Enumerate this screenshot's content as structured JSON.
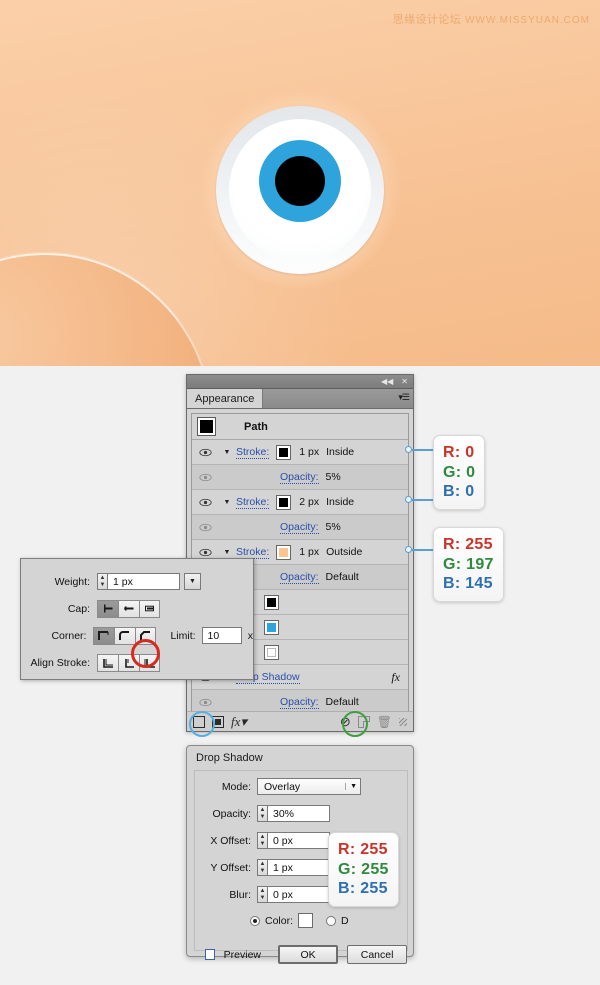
{
  "watermark": {
    "cn": "思缘设计论坛",
    "url": "WWW.MISSYUAN.COM"
  },
  "illustration": {
    "name": "eye-illustration",
    "background_color": "#f7c496",
    "iris_color": "#2fa3dc",
    "pupil_color": "#000000",
    "sclera_color": "#ffffff"
  },
  "appearance_panel": {
    "tab_label": "Appearance",
    "collapse_icon": "◀◀",
    "close_icon": "✕",
    "menu_icon": "▾☰",
    "header_row": {
      "label": "Path"
    },
    "rows": [
      {
        "label": "Stroke:",
        "value": "1 px",
        "align": "Inside",
        "swatch": "black"
      },
      {
        "label": "Opacity:",
        "value": "5%"
      },
      {
        "label": "Stroke:",
        "value": "2 px",
        "align": "Inside",
        "swatch": "black"
      },
      {
        "label": "Opacity:",
        "value": "5%"
      },
      {
        "label": "Stroke:",
        "value": "1 px",
        "align": "Outside",
        "swatch": "orange"
      },
      {
        "label": "Opacity:",
        "value": "Default"
      },
      {
        "label": "",
        "value": "",
        "swatch": "black"
      },
      {
        "label": "",
        "value": "",
        "swatch": "blue"
      },
      {
        "label": "",
        "value": "",
        "swatch": "white"
      },
      {
        "label": "Drop Shadow",
        "value": "",
        "fx": "fx"
      },
      {
        "label": "Opacity:",
        "value": "Default"
      }
    ],
    "footer": {
      "add_new_stroke_icon": "stroke-square",
      "add_new_fill_icon": "fill-square",
      "fx_icon": "fx",
      "clear_icon": "⃠",
      "duplicate_icon": "duplicate",
      "delete_icon": "🗑",
      "grip_icon": "grip"
    }
  },
  "stroke_popup": {
    "weight": {
      "label": "Weight:",
      "value": "1 px"
    },
    "cap": {
      "label": "Cap:"
    },
    "corner": {
      "label": "Corner:"
    },
    "limit": {
      "label": "Limit:",
      "value": "10",
      "unit": "x"
    },
    "align_stroke": {
      "label": "Align Stroke:"
    }
  },
  "callouts": [
    {
      "r": "R: 0",
      "g": "G: 0",
      "b": "B: 0"
    },
    {
      "r": "R: 255",
      "g": "G: 197",
      "b": "B: 145"
    },
    {
      "r": "R: 255",
      "g": "G: 255",
      "b": "B: 255"
    }
  ],
  "drop_shadow_dialog": {
    "title": "Drop Shadow",
    "mode": {
      "label": "Mode:",
      "value": "Overlay"
    },
    "opacity": {
      "label": "Opacity:",
      "value": "30%"
    },
    "x_offset": {
      "label": "X Offset:",
      "value": "0 px"
    },
    "y_offset": {
      "label": "Y Offset:",
      "value": "1 px"
    },
    "blur": {
      "label": "Blur:",
      "value": "0 px"
    },
    "color_radio_label": "Color:",
    "darkness_radio_label": "D",
    "preview_label": "Preview",
    "ok_label": "OK",
    "cancel_label": "Cancel"
  }
}
